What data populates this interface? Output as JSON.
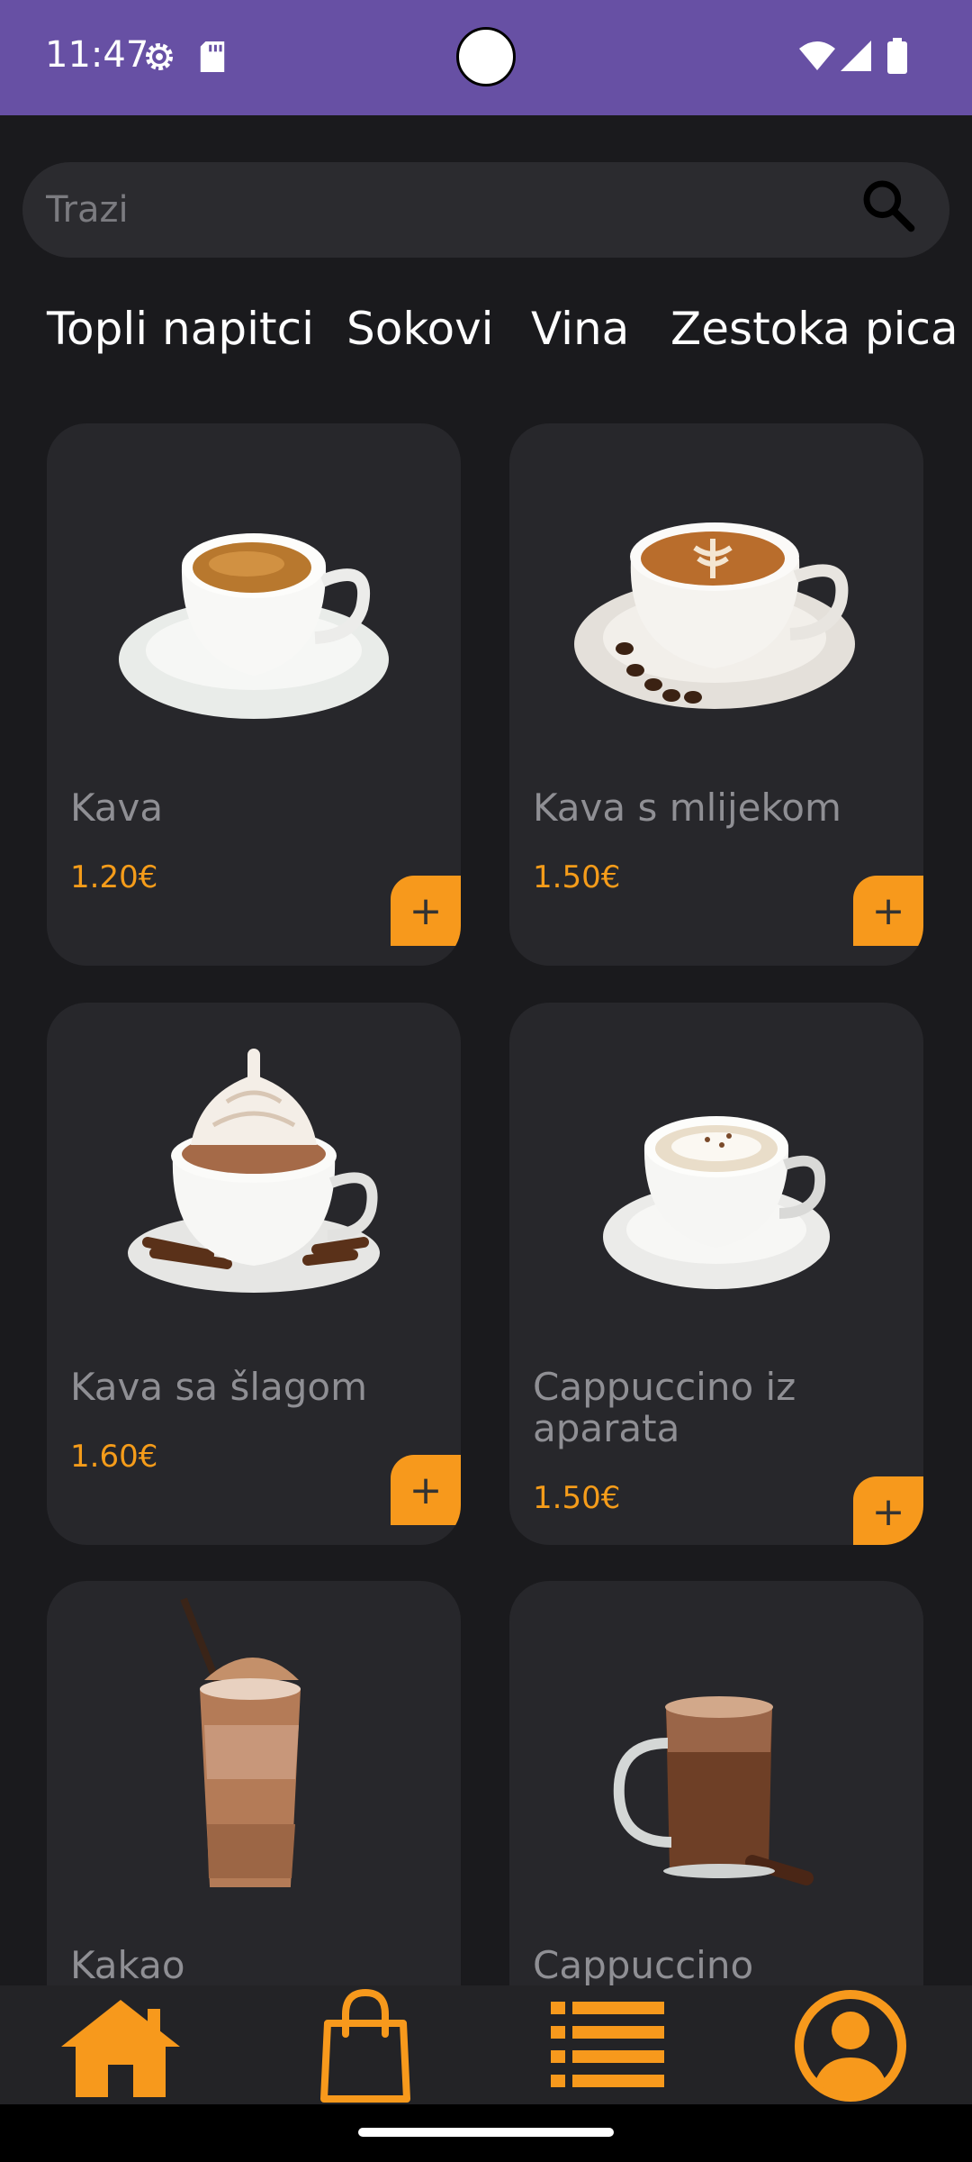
{
  "status_bar": {
    "time": "11:47",
    "icons": [
      "settings-icon",
      "sd-card-icon",
      "wifi-icon",
      "signal-icon",
      "battery-icon"
    ]
  },
  "search": {
    "placeholder": "Trazi",
    "icon": "search-icon"
  },
  "categories": [
    "Topli napitci",
    "Sokovi",
    "Vina",
    "Zestoka pica"
  ],
  "products": [
    {
      "name": "Kava",
      "price": "1.20€",
      "image": "espresso-cup"
    },
    {
      "name": "Kava s mlijekom",
      "price": "1.50€",
      "image": "latte-cup"
    },
    {
      "name": "Kava sa šlagom",
      "price": "1.60€",
      "image": "whipped-cream-cup"
    },
    {
      "name": "Cappuccino iz aparata",
      "price": "1.50€",
      "image": "cappuccino-cup"
    },
    {
      "name": "Kakao",
      "price": "",
      "image": "iced-cocoa-glass"
    },
    {
      "name": "Cappuccino",
      "price": "",
      "image": "cappuccino-glass-mug"
    }
  ],
  "add_label": "+",
  "bottom_nav": [
    "home-icon",
    "shopping-bag-icon",
    "list-icon",
    "profile-icon"
  ],
  "colors": {
    "status_bar": "#6750a4",
    "background": "#1a1a1d",
    "card": "#27272b",
    "accent": "#f7991c",
    "price": "#f59c1a"
  }
}
